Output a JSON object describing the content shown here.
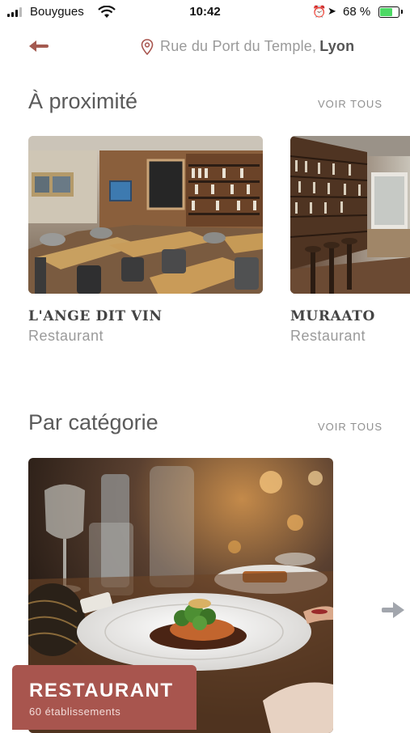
{
  "status_bar": {
    "carrier": "Bouygues",
    "time": "10:42",
    "battery": "68 %",
    "battery_level": 0.68
  },
  "header": {
    "address": "Rue du Port du Temple,",
    "city": "Lyon"
  },
  "nearby": {
    "title": "À proximité",
    "see_all": "VOIR TOUS",
    "venues": [
      {
        "name": "L'ANGE DIT VIN",
        "type": "Restaurant"
      },
      {
        "name": "MURAATO",
        "type": "Restaurant"
      }
    ]
  },
  "categories": {
    "title": "Par catégorie",
    "see_all": "VOIR TOUS",
    "items": [
      {
        "title": "RESTAURANT",
        "count": "60 établissements"
      }
    ]
  },
  "colors": {
    "accent": "#a8554e",
    "muted_text": "#9a9a9a",
    "heading": "#5a5a5a"
  }
}
